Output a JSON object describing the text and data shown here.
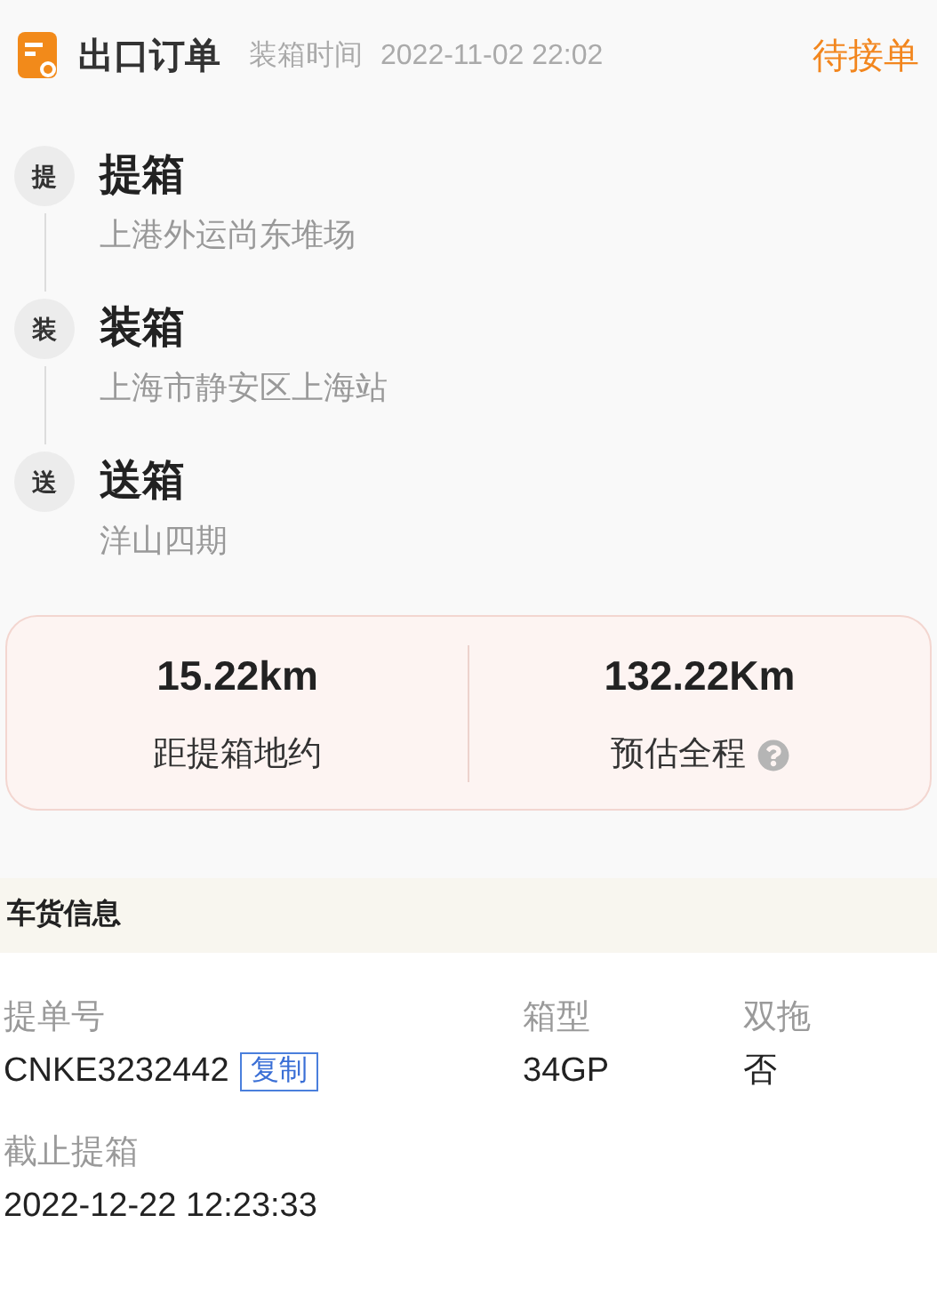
{
  "header": {
    "title": "出口订单",
    "time_label": "装箱时间",
    "time": "2022-11-02 22:02",
    "status": "待接单"
  },
  "stops": [
    {
      "badge": "提",
      "title": "提箱",
      "place": "上港外运尚东堆场"
    },
    {
      "badge": "装",
      "title": "装箱",
      "place": "上海市静安区上海站"
    },
    {
      "badge": "送",
      "title": "送箱",
      "place": "洋山四期"
    }
  ],
  "distance": [
    {
      "value": "15.22km",
      "label": "距提箱地约",
      "help": false
    },
    {
      "value": "132.22Km",
      "label": "预估全程",
      "help": true
    }
  ],
  "section": {
    "title": "车货信息"
  },
  "fields": [
    {
      "label": "提单号",
      "value": "CNKE3232442",
      "copy": "复制"
    },
    {
      "label": "箱型",
      "value": "34GP"
    },
    {
      "label": "双拖",
      "value": "否"
    },
    {
      "label": "截止提箱",
      "value": "2022-12-22 12:23:33"
    }
  ]
}
